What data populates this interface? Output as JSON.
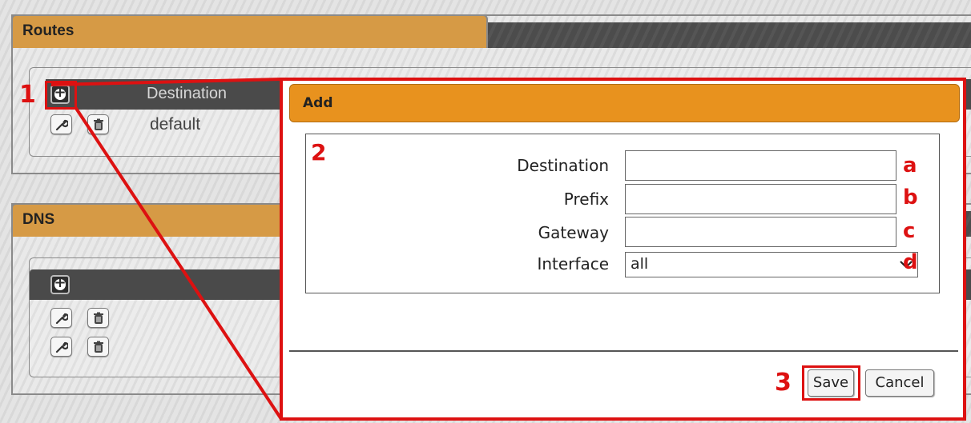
{
  "routes": {
    "title": "Routes",
    "column_destination": "Destination",
    "rows": [
      {
        "destination": "default"
      }
    ]
  },
  "dns": {
    "title": "DNS"
  },
  "dialog": {
    "title": "Add",
    "fields": {
      "destination_label": "Destination",
      "destination_value": "",
      "prefix_label": "Prefix",
      "prefix_value": "",
      "gateway_label": "Gateway",
      "gateway_value": "",
      "interface_label": "Interface",
      "interface_value": "all"
    },
    "save_label": "Save",
    "cancel_label": "Cancel"
  },
  "annotations": {
    "step1": "1",
    "step2": "2",
    "step3": "3",
    "a": "a",
    "b": "b",
    "c": "c",
    "d": "d"
  },
  "colors": {
    "accent_orange": "#e8921e",
    "panel_orange": "#d69a45",
    "annotation_red": "#dd1111",
    "header_dark": "#4a4a4a"
  },
  "icons": [
    "add-icon",
    "wrench-icon",
    "trash-icon",
    "chevron-down-icon"
  ]
}
